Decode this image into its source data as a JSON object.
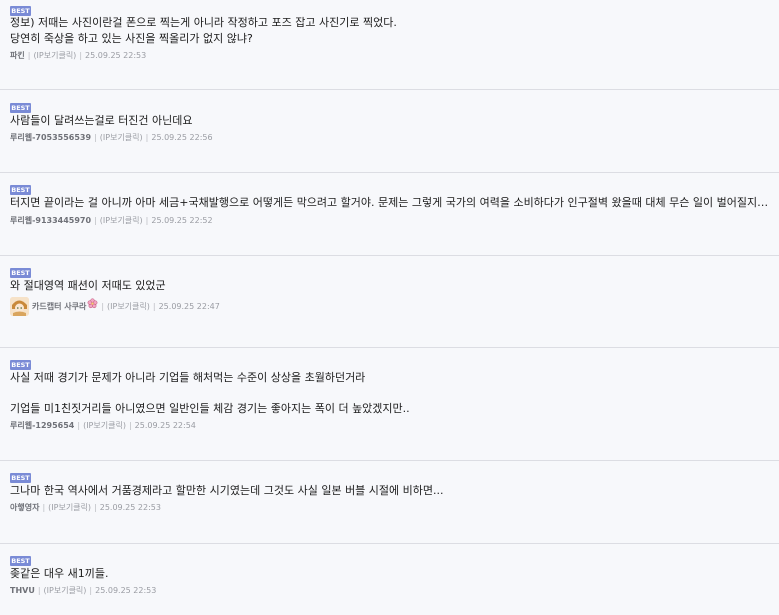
{
  "badge": "BEST",
  "separator": "|",
  "comments": [
    {
      "lines": [
        "정보) 저때는 사진이란걸 폰으로 찍는게 아니라 작정하고 포즈 잡고 사진기로 찍었다.",
        "당연히 죽상을 하고 있는 사진을 찍올리가 없지 않냐?"
      ],
      "author": "파킨",
      "ip": "(IP보기클릭)",
      "time": "25.09.25 22:53"
    },
    {
      "lines": [
        "사람들이 달려쓰는걸로 터진건 아닌데요"
      ],
      "author": "루리웹-7053556539",
      "ip": "(IP보기클릭)",
      "time": "25.09.25 22:56"
    },
    {
      "lines": [
        "터지면 끝이라는 걸 아니까 아마 세금+국채발행으로 어떻게든 막으려고 할거야. 문제는 그렇게 국가의 여력을 소비하다가 인구절벽 왔을때 대체 무슨 일이 벌어질지가.."
      ],
      "author": "루리웹-9133445970",
      "ip": "(IP보기클릭)",
      "time": "25.09.25 22:52"
    },
    {
      "lines": [
        "와 절대영역 패션이 저때도 있었군"
      ],
      "author": "카드캡터 사쿠라",
      "ip": "(IP보기클릭)",
      "time": "25.09.25 22:47",
      "avatar": "sakura-avatar",
      "badge_icon": "sakura-flower-icon"
    },
    {
      "lines": [
        "사실 저때 경기가 문제가 아니라 기업들 해처먹는 수준이 상상을 초월하던거라",
        "",
        "기업들 미1친짓거리들 아니였으면 일반인들 체감 경기는 좋아지는 폭이 더 높았겠지만.."
      ],
      "author": "루리웹-1295654",
      "ip": "(IP보기클릭)",
      "time": "25.09.25 22:54"
    },
    {
      "lines": [
        "그나마 한국 역사에서 거품경제라고 할만한 시기였는데 그것도 사실 일본 버블 시절에 비하면..."
      ],
      "author": "아햏영자",
      "ip": "(IP보기클릭)",
      "time": "25.09.25 22:53"
    },
    {
      "lines": [
        "좆같은 대우 새1끼들."
      ],
      "author": "THVU",
      "ip": "(IP보기클릭)",
      "time": "25.09.25 22:53"
    }
  ]
}
